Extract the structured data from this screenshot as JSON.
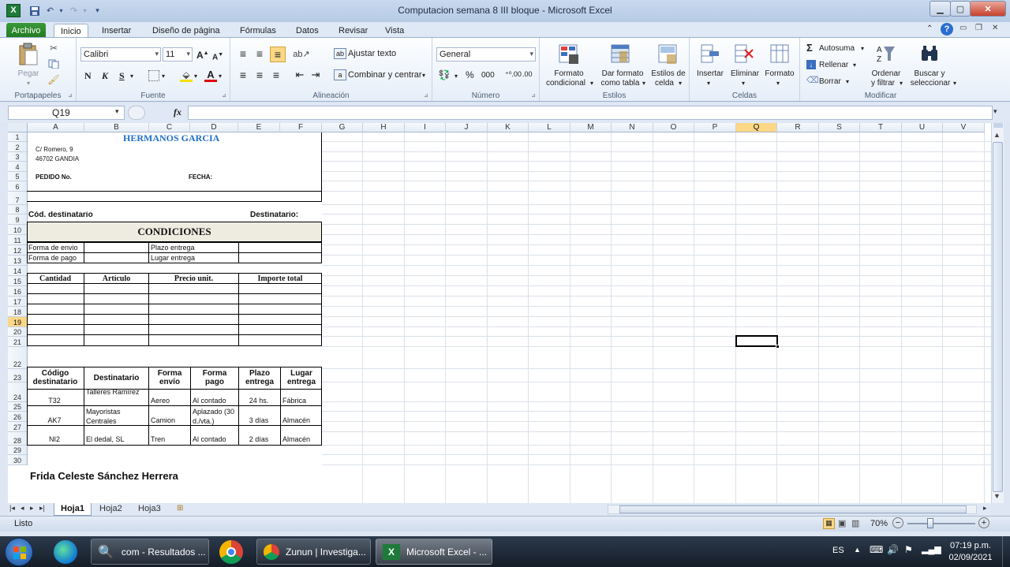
{
  "window": {
    "title": "Computacion semana 8 III bloque  -  Microsoft Excel"
  },
  "ribbon_tabs": [
    "Archivo",
    "Inicio",
    "Insertar",
    "Diseño de página",
    "Fórmulas",
    "Datos",
    "Revisar",
    "Vista"
  ],
  "ribbon": {
    "clipboard": {
      "label": "Portapapeles",
      "paste": "Pegar"
    },
    "font": {
      "label": "Fuente",
      "name": "Calibri",
      "size": "11",
      "bold": "N",
      "italic": "K",
      "underline": "S"
    },
    "alignment": {
      "label": "Alineación",
      "wrap": "Ajustar texto",
      "merge": "Combinar y centrar"
    },
    "number": {
      "label": "Número",
      "format": "General",
      "percent": "%",
      "thousands": "000"
    },
    "styles": {
      "label": "Estilos",
      "cond1": "Formato",
      "cond2": "condicional",
      "table1": "Dar formato",
      "table2": "como tabla",
      "cell1": "Estilos de",
      "cell2": "celda"
    },
    "cells": {
      "label": "Celdas",
      "insert": "Insertar",
      "delete": "Eliminar",
      "format": "Formato"
    },
    "edit": {
      "label": "Modificar",
      "autosum": "Autosuma",
      "fill": "Rellenar",
      "clear": "Borrar",
      "sort1": "Ordenar",
      "sort2": "y filtrar",
      "find1": "Buscar y",
      "find2": "seleccionar"
    }
  },
  "formula_bar": {
    "name_box": "Q19",
    "fx": "fx",
    "value": ""
  },
  "columns": [
    "A",
    "B",
    "C",
    "D",
    "E",
    "F",
    "G",
    "H",
    "I",
    "J",
    "K",
    "L",
    "M",
    "N",
    "O",
    "P",
    "Q",
    "R",
    "S",
    "T",
    "U",
    "V"
  ],
  "rows": [
    "1",
    "2",
    "3",
    "4",
    "5",
    "6",
    "7",
    "8",
    "9",
    "10",
    "11",
    "12",
    "13",
    "14",
    "15",
    "16",
    "17",
    "18",
    "19",
    "20",
    "21",
    "22",
    "23",
    "24",
    "25",
    "26",
    "27",
    "28",
    "29",
    "30"
  ],
  "sheet": {
    "company": "HERMANOS GARCIA",
    "address1": "C/ Romero, 9",
    "address2": "46702 GANDIA",
    "order_no": "PEDIDO No.",
    "date": "FECHA:",
    "dest_code": "Cód. destinatario",
    "dest": "Destinatario:",
    "conditions": "CONDICIONES",
    "ship_form": "Forma de envio",
    "pay_form": "Forma de pago",
    "term": "Plazo entrega",
    "place": "Lugar entrega",
    "items_headers": [
      "Cantidad",
      "Artículo",
      "Precio unit.",
      "Importe total"
    ],
    "table_headers": [
      [
        "Código",
        "destinatario"
      ],
      [
        "Destinatario"
      ],
      [
        "Forma",
        "envío"
      ],
      [
        "Forma",
        "pago"
      ],
      [
        "Plazo",
        "entrega"
      ],
      [
        "Lugar",
        "entrega"
      ]
    ],
    "rows": [
      [
        "T32",
        "Talleres Ramírez",
        "Aereo",
        "Al contado",
        "24 hs.",
        "Fábrica"
      ],
      [
        "AK7",
        "Mayoristas Centrales",
        "Camion",
        "Aplazado (30 d./vta.)",
        "3 días",
        "Almacén"
      ],
      [
        "NI2",
        "El dedal, SL",
        "Tren",
        "Al contado",
        "2 días",
        "Almacén"
      ]
    ],
    "author": "Frida Celeste Sánchez Herrera"
  },
  "sheet_tabs": [
    "Hoja1",
    "Hoja2",
    "Hoja3"
  ],
  "status": {
    "ready": "Listo",
    "zoom": "70%"
  },
  "taskbar": {
    "items": [
      "com - Resultados ...",
      "Zunun | Investiga...",
      "Microsoft Excel - ..."
    ],
    "lang": "ES",
    "time": "07:19 p.m.",
    "date": "02/09/2021"
  }
}
